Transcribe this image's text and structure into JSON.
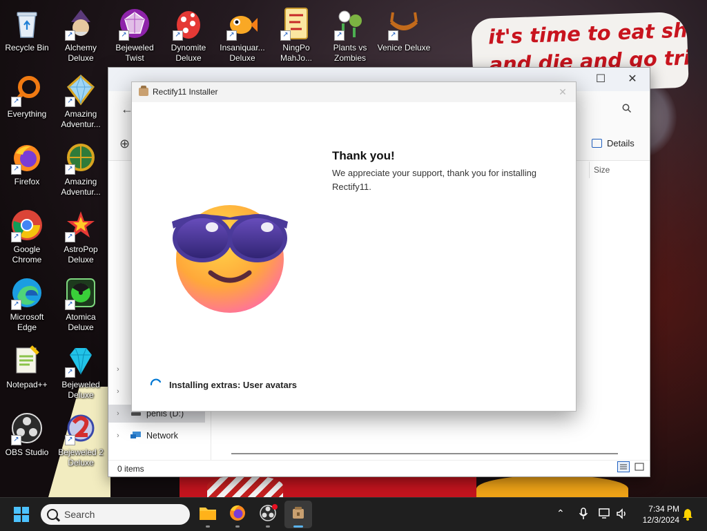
{
  "wallpaper": {
    "note_line1": "it's time to eat shit",
    "note_line2": "and die and go trick"
  },
  "desktop": {
    "icons": [
      {
        "label": "Recycle Bin",
        "icon": "recycle-bin-icon"
      },
      {
        "label": "Alchemy Deluxe",
        "icon": "alchemy-deluxe-icon"
      },
      {
        "label": "Bejeweled Twist",
        "icon": "bejeweled-twist-icon"
      },
      {
        "label": "Dynomite Deluxe",
        "icon": "dynomite-deluxe-icon"
      },
      {
        "label": "Insaniquar... Deluxe",
        "icon": "insaniquarium-icon"
      },
      {
        "label": "NingPo MahJo...",
        "icon": "ningpo-mahjong-icon"
      },
      {
        "label": "Plants vs Zombies",
        "icon": "plants-vs-zombies-icon"
      },
      {
        "label": "Venice Deluxe",
        "icon": "venice-deluxe-icon"
      },
      {
        "label": "Everything",
        "icon": "everything-search-icon"
      },
      {
        "label": "Amazing Adventur...",
        "icon": "amazing-adventures-icon"
      },
      {
        "label": "Firefox",
        "icon": "firefox-icon"
      },
      {
        "label": "Amazing Adventur...",
        "icon": "amazing-adventures-2-icon"
      },
      {
        "label": "Google Chrome",
        "icon": "chrome-icon"
      },
      {
        "label": "AstroPop Deluxe",
        "icon": "astropop-icon"
      },
      {
        "label": "Microsoft Edge",
        "icon": "edge-icon"
      },
      {
        "label": "Atomica Deluxe",
        "icon": "atomica-icon"
      },
      {
        "label": "Notepad++",
        "icon": "notepad-plus-plus-icon"
      },
      {
        "label": "Bejeweled Deluxe",
        "icon": "bejeweled-deluxe-icon"
      },
      {
        "label": "OBS Studio",
        "icon": "obs-studio-icon"
      },
      {
        "label": "Bejeweled 2 Deluxe",
        "icon": "bejeweled-2-icon"
      }
    ]
  },
  "explorer": {
    "toolbar_details_label": "Details",
    "column_size": "Size",
    "nav_items": [
      {
        "label": "penis (D:)",
        "icon": "drive-icon",
        "selected": true
      },
      {
        "label": "Network",
        "icon": "network-icon",
        "selected": false
      }
    ],
    "status_items": "0 items"
  },
  "installer": {
    "title": "Rectify11 Installer",
    "heading": "Thank you!",
    "body": "We appreciate your support, thank you for installing Rectify11.",
    "progress_text": "Installing extras: User avatars",
    "close_glyph": "✕"
  },
  "taskbar": {
    "search_label": "Search",
    "time": "7:34 PM",
    "date": "12/3/2024",
    "apps": [
      "file-explorer-icon",
      "firefox-icon",
      "obs-studio-icon",
      "rectify11-installer-icon"
    ]
  },
  "colors": {
    "accent": "#0078d4",
    "note_text": "#c8141e"
  }
}
